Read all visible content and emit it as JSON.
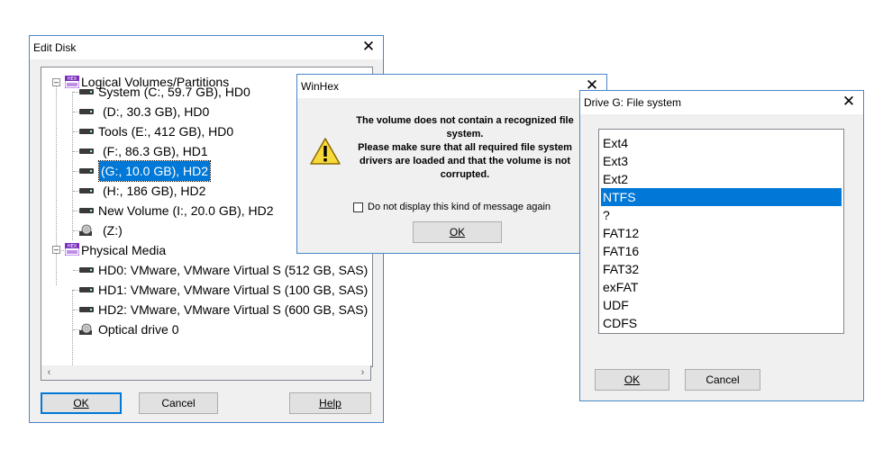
{
  "edit_disk": {
    "title": "Edit Disk",
    "close": "✕",
    "tree": {
      "logical_label": "Logical Volumes/Partitions",
      "logical": [
        "System (C:, 59.7 GB), HD0",
        "(D:, 30.3 GB), HD0",
        "Tools (E:, 412 GB), HD0",
        "(F:, 86.3 GB), HD1",
        "(G:, 10.0 GB), HD2",
        "(H:, 186 GB), HD2",
        "New Volume (I:, 20.0 GB), HD2",
        "(Z:)"
      ],
      "physical_label": "Physical Media",
      "physical": [
        "HD0: VMware, VMware Virtual S (512 GB, SAS)",
        "HD1: VMware, VMware Virtual S (100 GB, SAS)",
        "HD2: VMware, VMware Virtual S (600 GB, SAS)",
        "Optical drive 0"
      ],
      "selected": "(G:, 10.0 GB), HD2"
    },
    "buttons": {
      "ok": "OK",
      "cancel": "Cancel",
      "help": "Help"
    }
  },
  "winhex": {
    "title": "WinHex",
    "close": "✕",
    "message_line1": "The volume does not contain a recognized file system.",
    "message_line2": "Please make sure that all required file system drivers are loaded and that the volume is not corrupted.",
    "checkbox_label": "Do not display this kind of message again",
    "ok": "OK"
  },
  "fs_dialog": {
    "title": "Drive G: File system",
    "close": "✕",
    "items": [
      "Ext4",
      "Ext3",
      "Ext2",
      "NTFS",
      "?",
      "FAT12",
      "FAT16",
      "FAT32",
      "exFAT",
      "UDF",
      "CDFS"
    ],
    "selected": "NTFS",
    "buttons": {
      "ok": "OK",
      "cancel": "Cancel"
    }
  }
}
